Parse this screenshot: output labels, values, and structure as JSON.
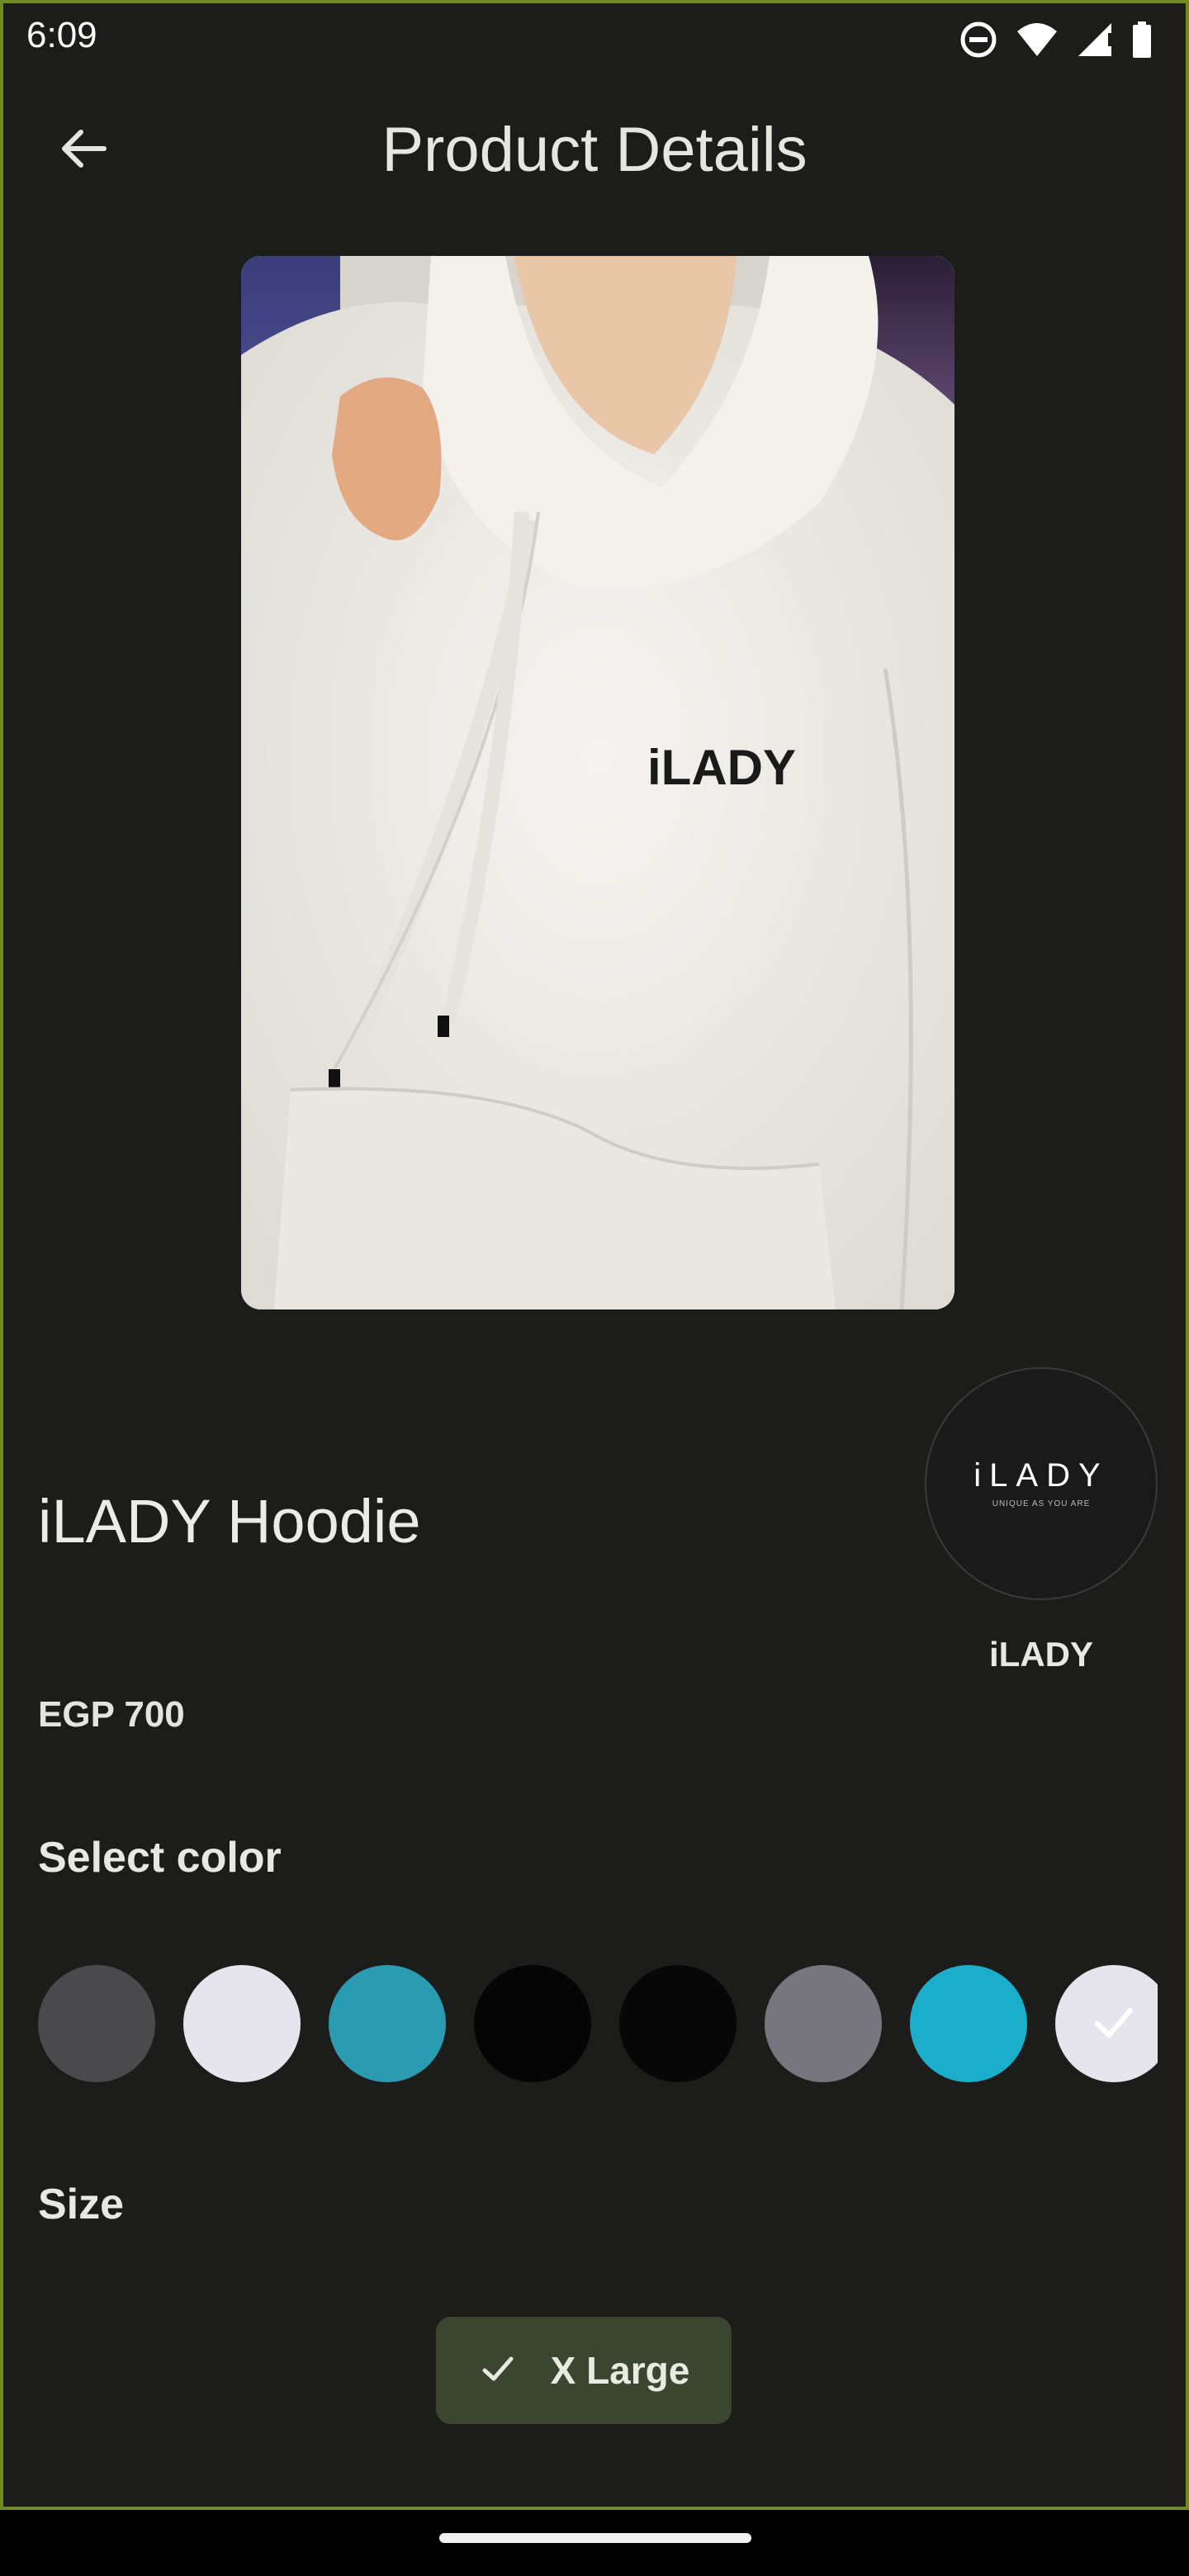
{
  "status_bar": {
    "time": "6:09",
    "icons": [
      "do-not-disturb-icon",
      "wifi-icon",
      "cellular-signal-icon",
      "battery-icon"
    ]
  },
  "app_bar": {
    "title": "Product Details",
    "back_icon": "arrow-left-icon"
  },
  "product": {
    "image_logo_text": "iLADY",
    "name": "iLADY Hoodie",
    "price": "EGP 700"
  },
  "brand": {
    "logo_text": "iLADY",
    "logo_tagline": "UNIQUE AS YOU ARE",
    "name": "iLADY"
  },
  "colors": {
    "label": "Select color",
    "swatches": [
      {
        "color": "#4a4a4c",
        "selected": false
      },
      {
        "color": "#e6e4ec",
        "selected": false
      },
      {
        "color": "#2a9bb0",
        "selected": false
      },
      {
        "color": "#050505",
        "selected": false
      },
      {
        "color": "#070707",
        "selected": false
      },
      {
        "color": "#77767e",
        "selected": false
      },
      {
        "color": "#1aaecb",
        "selected": false
      },
      {
        "color": "#e6e4ec",
        "selected": true
      }
    ]
  },
  "size": {
    "label": "Size",
    "selected": "X Large"
  },
  "theme": {
    "background": "#1c1d1a",
    "chip": "#3c4530",
    "accent_border": "#6f8a1e"
  }
}
